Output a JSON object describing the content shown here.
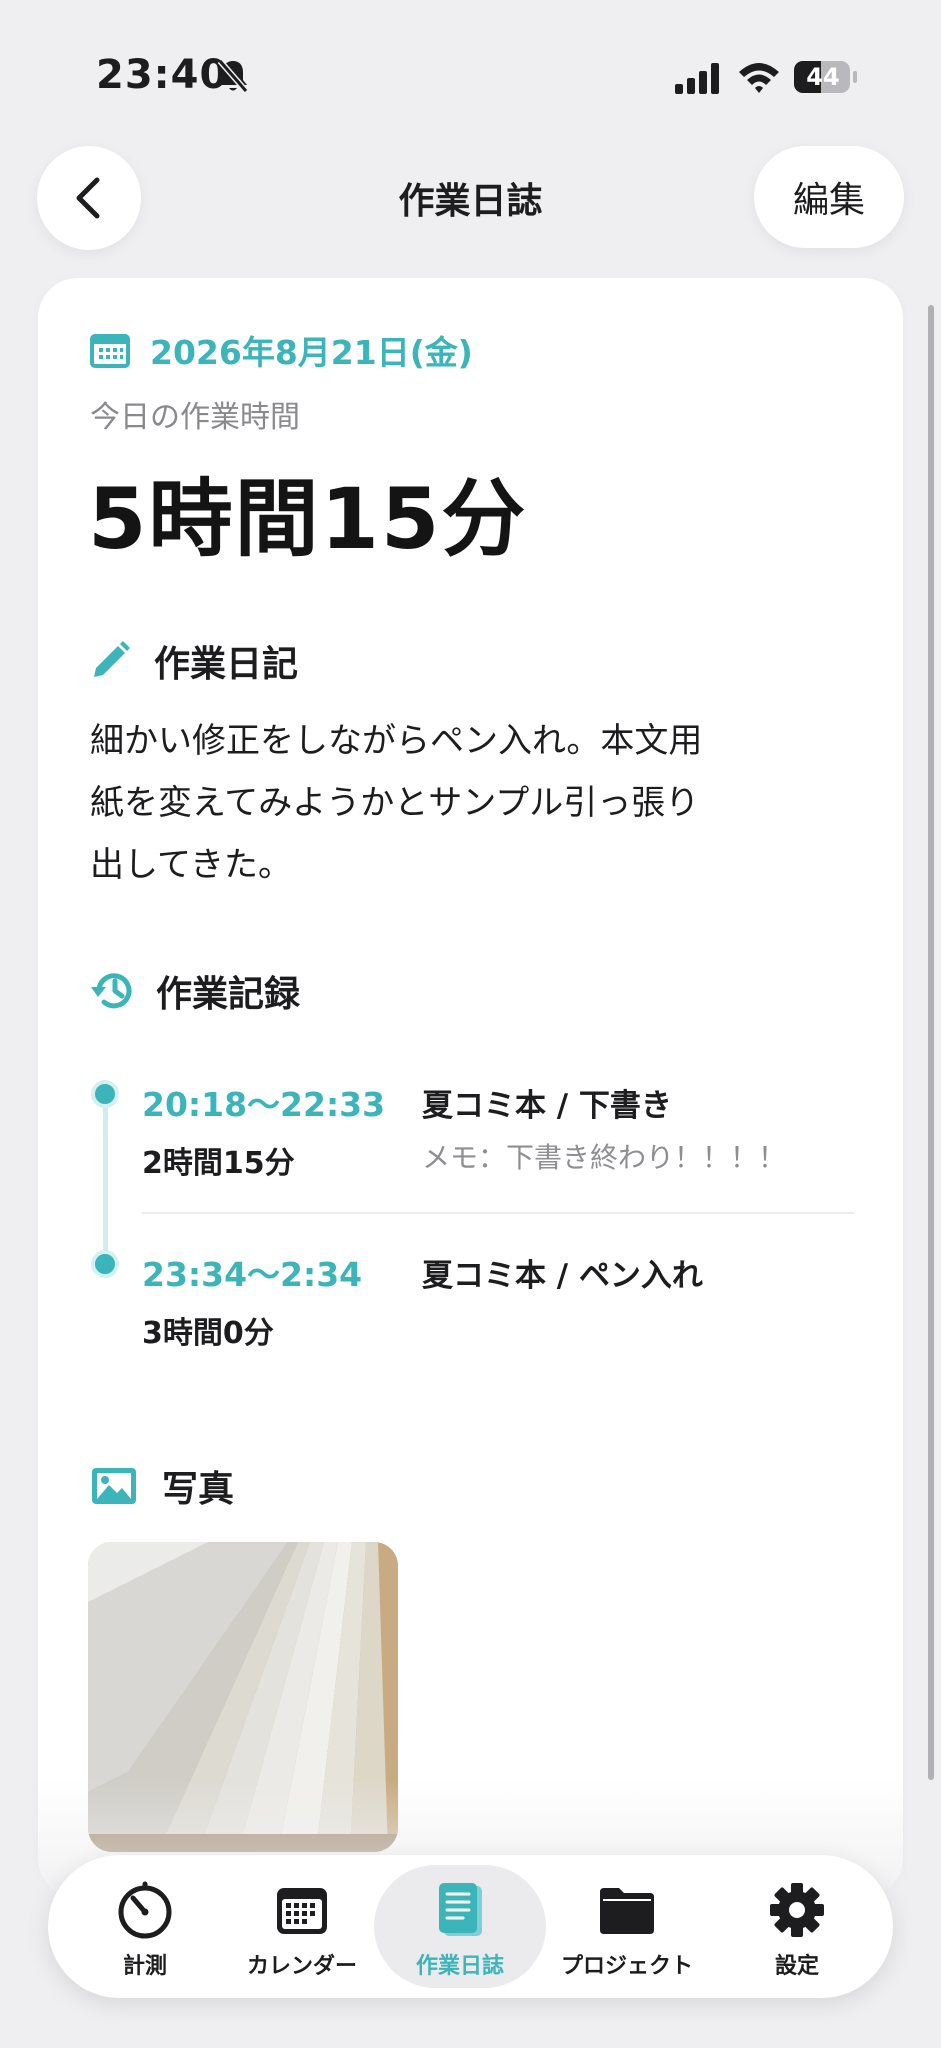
{
  "status_bar": {
    "time": "23:40",
    "battery": "44"
  },
  "nav": {
    "title": "作業日誌",
    "edit_label": "編集"
  },
  "log": {
    "date": "2026年8月21日(金)",
    "today_label": "今日の作業時間",
    "total_time": "5時間15分"
  },
  "diary": {
    "title": "作業日記",
    "lines": [
      "細かい修正をしながらペン入れ。本文用",
      "紙を変えてみようかとサンプル引っ張り",
      "出してきた。"
    ]
  },
  "records": {
    "title": "作業記録",
    "entries": [
      {
        "time": "20:18〜22:33",
        "duration": "2時間15分",
        "project": "夏コミ本 / 下書き",
        "memo": "メモ：下書き終わり！！！！"
      },
      {
        "time": "23:34〜2:34",
        "duration": "3時間0分",
        "project": "夏コミ本 / ペン入れ",
        "memo": ""
      }
    ]
  },
  "photos": {
    "title": "写真"
  },
  "tabs": [
    {
      "label": "計測",
      "icon": "timer-icon"
    },
    {
      "label": "カレンダー",
      "icon": "calendar-icon"
    },
    {
      "label": "作業日誌",
      "icon": "journal-icon"
    },
    {
      "label": "プロジェクト",
      "icon": "folder-icon"
    },
    {
      "label": "設定",
      "icon": "gear-icon"
    }
  ],
  "colors": {
    "accent": "#3bb4ba",
    "background": "#efeff1",
    "card": "#ffffff"
  }
}
